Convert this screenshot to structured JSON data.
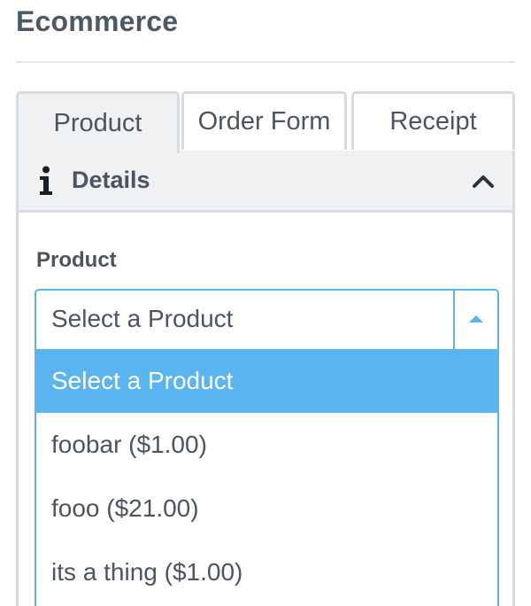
{
  "section": {
    "title": "Ecommerce"
  },
  "tabs": [
    {
      "label": "Product",
      "active": true
    },
    {
      "label": "Order Form",
      "active": false
    },
    {
      "label": "Receipt",
      "active": false
    }
  ],
  "panel": {
    "header_icon": "info-icon",
    "header_label": "Details",
    "collapse_icon": "chevron-up-icon"
  },
  "product_field": {
    "label": "Product",
    "selected_value": "Select a Product",
    "toggle_icon": "caret-up-icon",
    "options": [
      {
        "label": "Select a Product",
        "highlighted": true
      },
      {
        "label": "foobar ($1.00)",
        "highlighted": false
      },
      {
        "label": "fooo ($21.00)",
        "highlighted": false
      },
      {
        "label": "its a thing ($1.00)",
        "highlighted": false
      }
    ]
  },
  "colors": {
    "accent": "#5ab4ea",
    "highlight": "#5ab4f0",
    "header_bg": "#eff1f3",
    "border": "#d6dbdf",
    "text": "#4a5560"
  }
}
